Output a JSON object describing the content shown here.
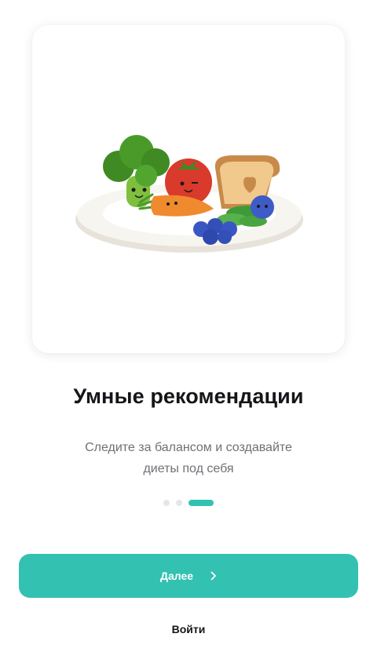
{
  "onboarding": {
    "illustration": "plate-with-broccoli-tomato-toast-carrot-blueberries",
    "title": "Умные рекомендации",
    "subtitle_line1": "Следите за балансом и создавайте",
    "subtitle_line2": "диеты под себя",
    "pagination": {
      "total": 3,
      "current": 3
    },
    "next_label": "Далее",
    "next_icon": "chevron-right-icon",
    "login_label": "Войти"
  },
  "colors": {
    "accent": "#33c1b2",
    "title": "#16161a",
    "subtitle": "#6f6f76",
    "dot_inactive": "#e6e6ea"
  }
}
